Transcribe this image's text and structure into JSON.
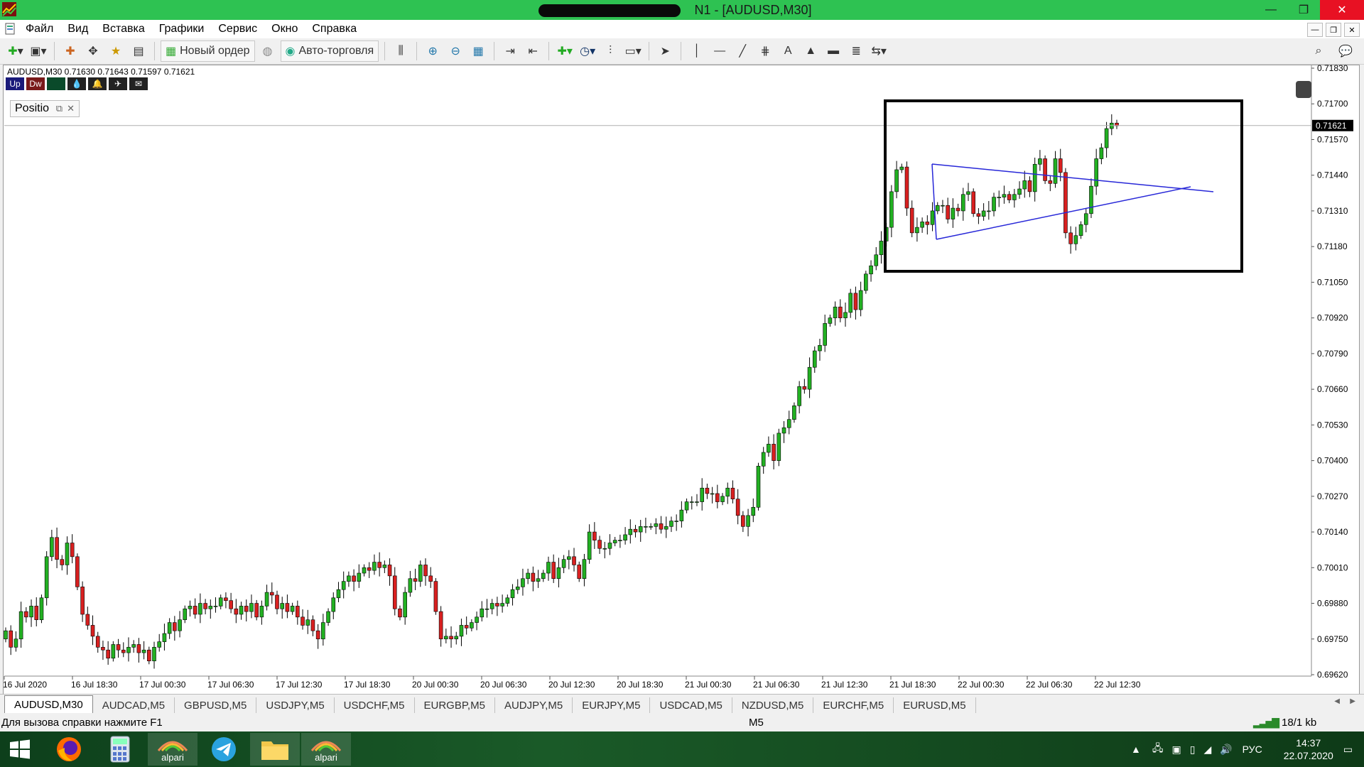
{
  "window": {
    "title": "N1 - [AUDUSD,M30]"
  },
  "menu": [
    "Файл",
    "Вид",
    "Вставка",
    "Графики",
    "Сервис",
    "Окно",
    "Справка"
  ],
  "toolbar": {
    "new_order": "Новый ордер",
    "auto_trading": "Авто-торговля"
  },
  "chart": {
    "info": "AUDUSD,M30  0.71630 0.71643 0.71597 0.71621",
    "buttons": [
      "Up",
      "Dw"
    ],
    "position_label": "Positio",
    "current_price": "0.71621",
    "price_ticks": [
      "0.71830",
      "0.71700",
      "0.71570",
      "0.71440",
      "0.71310",
      "0.71180",
      "0.71050",
      "0.70920",
      "0.70790",
      "0.70660",
      "0.70530",
      "0.70400",
      "0.70270",
      "0.70140",
      "0.70010",
      "0.69880",
      "0.69750",
      "0.69620"
    ],
    "time_ticks": [
      "16 Jul 2020",
      "16 Jul 18:30",
      "17 Jul 00:30",
      "17 Jul 06:30",
      "17 Jul 12:30",
      "17 Jul 18:30",
      "20 Jul 00:30",
      "20 Jul 06:30",
      "20 Jul 12:30",
      "20 Jul 18:30",
      "21 Jul 00:30",
      "21 Jul 06:30",
      "21 Jul 12:30",
      "21 Jul 18:30",
      "22 Jul 00:30",
      "22 Jul 06:30",
      "22 Jul 12:30"
    ]
  },
  "chart_data": {
    "type": "candlestick",
    "symbol": "AUDUSD",
    "timeframe": "M30",
    "ylim": [
      0.6962,
      0.7183
    ],
    "close": [
      0.6978,
      0.6972,
      0.6975,
      0.6985,
      0.6983,
      0.6987,
      0.6982,
      0.699,
      0.7005,
      0.7012,
      0.7004,
      0.7002,
      0.701,
      0.7005,
      0.6994,
      0.6984,
      0.698,
      0.6976,
      0.6972,
      0.6971,
      0.6968,
      0.6973,
      0.6971,
      0.697,
      0.6972,
      0.6973,
      0.697,
      0.6971,
      0.6967,
      0.6972,
      0.6974,
      0.6977,
      0.6981,
      0.6978,
      0.6982,
      0.6986,
      0.6987,
      0.6984,
      0.6988,
      0.6986,
      0.6987,
      0.6987,
      0.699,
      0.6989,
      0.6986,
      0.6984,
      0.6987,
      0.6985,
      0.6988,
      0.6983,
      0.6987,
      0.6992,
      0.6991,
      0.6986,
      0.6988,
      0.6985,
      0.6987,
      0.6983,
      0.698,
      0.6982,
      0.6978,
      0.6975,
      0.6981,
      0.6985,
      0.699,
      0.6993,
      0.6996,
      0.6998,
      0.6996,
      0.6999,
      0.7001,
      0.7,
      0.7003,
      0.7001,
      0.7002,
      0.6998,
      0.6986,
      0.6983,
      0.6992,
      0.6997,
      0.6996,
      0.7002,
      0.6998,
      0.6996,
      0.6985,
      0.6975,
      0.6976,
      0.6975,
      0.6976,
      0.698,
      0.6979,
      0.6981,
      0.6983,
      0.6986,
      0.6986,
      0.6988,
      0.6987,
      0.6988,
      0.699,
      0.6993,
      0.6994,
      0.6997,
      0.6999,
      0.6996,
      0.6997,
      0.6999,
      0.7003,
      0.6997,
      0.7001,
      0.7004,
      0.7005,
      0.7002,
      0.6997,
      0.7004,
      0.7014,
      0.7011,
      0.7008,
      0.7008,
      0.701,
      0.7011,
      0.7011,
      0.7013,
      0.7015,
      0.7014,
      0.7016,
      0.7016,
      0.7016,
      0.7017,
      0.7015,
      0.7016,
      0.7018,
      0.7018,
      0.7022,
      0.7025,
      0.7025,
      0.7025,
      0.703,
      0.7028,
      0.7028,
      0.7025,
      0.7027,
      0.703,
      0.7026,
      0.702,
      0.7016,
      0.702,
      0.7023,
      0.7038,
      0.7043,
      0.7046,
      0.704,
      0.705,
      0.7052,
      0.7055,
      0.706,
      0.7067,
      0.7066,
      0.7074,
      0.708,
      0.7082,
      0.709,
      0.7092,
      0.7096,
      0.7092,
      0.7094,
      0.7101,
      0.7095,
      0.7102,
      0.7108,
      0.7111,
      0.7115,
      0.712,
      0.7125,
      0.7138,
      0.7146,
      0.7147,
      0.7132,
      0.7123,
      0.7125,
      0.7127,
      0.7126,
      0.7131,
      0.7133,
      0.7133,
      0.7128,
      0.7132,
      0.7131,
      0.7137,
      0.7138,
      0.713,
      0.7129,
      0.7131,
      0.7131,
      0.7136,
      0.7136,
      0.7137,
      0.7135,
      0.7137,
      0.7139,
      0.7142,
      0.7138,
      0.7148,
      0.715,
      0.7142,
      0.7141,
      0.715,
      0.7145,
      0.7123,
      0.7119,
      0.7122,
      0.7126,
      0.713,
      0.714,
      0.715,
      0.7154,
      0.7161,
      0.7163,
      0.7162
    ]
  },
  "tabs": [
    "AUDUSD,M30",
    "AUDCAD,M5",
    "GBPUSD,M5",
    "USDJPY,M5",
    "USDCHF,M5",
    "EURGBP,M5",
    "AUDJPY,M5",
    "EURJPY,M5",
    "USDCAD,M5",
    "NZDUSD,M5",
    "EURCHF,M5",
    "EURUSD,M5"
  ],
  "status": {
    "help": "Для вызова справки нажмите F1",
    "profile": "M5",
    "traffic": "18/1 kb"
  },
  "taskbar": {
    "app1": "alpari",
    "app2": "alpari",
    "lang": "РУС",
    "time": "14:37",
    "date": "22.07.2020"
  },
  "colors": {
    "bull": "#22b022",
    "bear": "#d82020",
    "trendline": "#2727d8",
    "titlebar": "#2ec252"
  }
}
